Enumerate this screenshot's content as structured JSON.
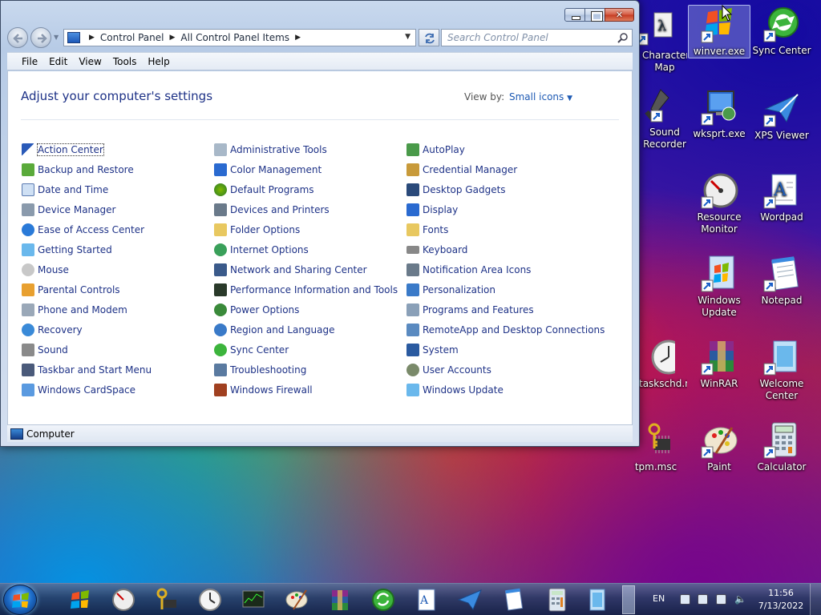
{
  "window": {
    "address": {
      "crumbs": [
        "Control Panel",
        "All Control Panel Items"
      ]
    },
    "search_placeholder": "Search Control Panel",
    "menu": [
      "File",
      "Edit",
      "View",
      "Tools",
      "Help"
    ],
    "heading": "Adjust your computer's settings",
    "view_by_label": "View by:",
    "view_by_value": "Small icons",
    "items_col1": [
      "Action Center",
      "Backup and Restore",
      "Date and Time",
      "Device Manager",
      "Ease of Access Center",
      "Getting Started",
      "Mouse",
      "Parental Controls",
      "Phone and Modem",
      "Recovery",
      "Sound",
      "Taskbar and Start Menu",
      "Windows CardSpace"
    ],
    "items_col2": [
      "Administrative Tools",
      "Color Management",
      "Default Programs",
      "Devices and Printers",
      "Folder Options",
      "Internet Options",
      "Network and Sharing Center",
      "Performance Information and Tools",
      "Power Options",
      "Region and Language",
      "Sync Center",
      "Troubleshooting",
      "Windows Firewall"
    ],
    "items_col3": [
      "AutoPlay",
      "Credential Manager",
      "Desktop Gadgets",
      "Display",
      "Fonts",
      "Keyboard",
      "Notification Area Icons",
      "Personalization",
      "Programs and Features",
      "RemoteApp and Desktop Connections",
      "System",
      "User Accounts",
      "Windows Update"
    ],
    "status_text": "Computer"
  },
  "desktop_icons": [
    {
      "label": "Character\nMap",
      "icon": "character-map-icon"
    },
    {
      "label": "winver.exe",
      "icon": "windows-flag-icon"
    },
    {
      "label": "Sync Center",
      "icon": "sync-center-icon"
    },
    {
      "label": "Sound\nRecorder",
      "icon": "microphone-icon"
    },
    {
      "label": "wksprt.exe",
      "icon": "wksprt-icon"
    },
    {
      "label": "XPS Viewer",
      "icon": "xps-viewer-icon"
    },
    {
      "label": "Resource\nMonitor",
      "icon": "resource-monitor-icon"
    },
    {
      "label": "Wordpad",
      "icon": "wordpad-icon"
    },
    {
      "label": "Windows\nUpdate",
      "icon": "windows-update-icon"
    },
    {
      "label": "Notepad",
      "icon": "notepad-icon"
    },
    {
      "label": "taskschd.msc",
      "icon": "clock-icon"
    },
    {
      "label": "WinRAR",
      "icon": "winrar-icon"
    },
    {
      "label": "Welcome\nCenter",
      "icon": "welcome-center-icon"
    },
    {
      "label": "tpm.msc",
      "icon": "tpm-chip-icon"
    },
    {
      "label": "Paint",
      "icon": "paint-icon"
    },
    {
      "label": "Calculator",
      "icon": "calculator-icon"
    }
  ],
  "taskbar": {
    "lang": "EN",
    "time": "11:56",
    "date": "7/13/2022"
  }
}
